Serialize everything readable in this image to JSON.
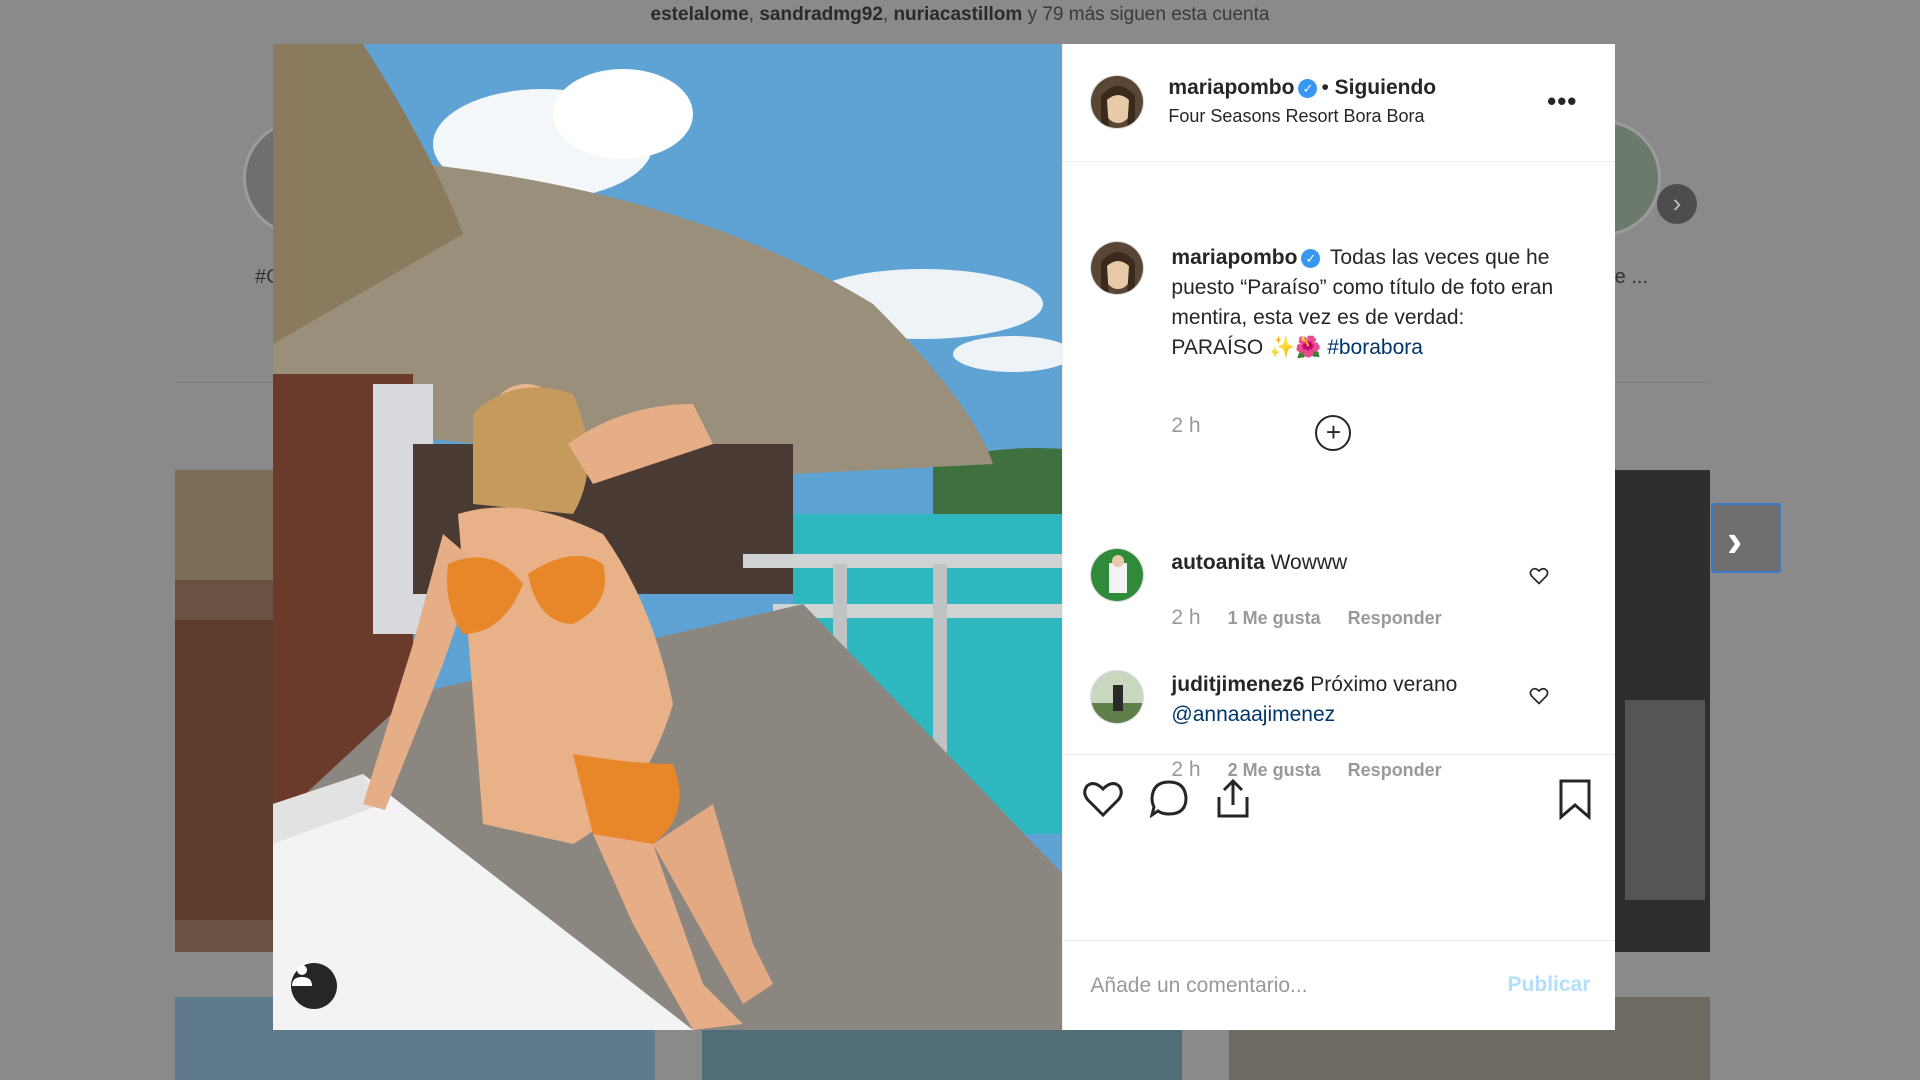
{
  "background": {
    "followed_by": {
      "users": [
        "estelalome",
        "sandradmg92",
        "nuriacastillom"
      ],
      "rest": "y 79 más siguen esta cuenta"
    },
    "story_labels": [
      "#C",
      "re ..."
    ],
    "next_arrow": "›",
    "story_next_arrow": "›"
  },
  "post": {
    "header": {
      "username": "mariapombo",
      "separator": "•",
      "follow_status": "Siguiendo",
      "location": "Four Seasons Resort Bora Bora",
      "more": "•••"
    },
    "caption": {
      "username": "mariapombo",
      "text": "Todas las veces que he puesto “Paraíso” como título de foto eran mentira, esta vez es de verdad:",
      "line2": "PARAÍSO ✨🌺",
      "hashtag": "#borabora",
      "time": "2 h",
      "load_more": "+"
    },
    "comments": [
      {
        "username": "autoanita",
        "text": "Wowww",
        "mention": "",
        "time": "2 h",
        "likes": "1 Me gusta",
        "reply": "Responder"
      },
      {
        "username": "juditjimenez6",
        "text": "Próximo verano",
        "mention": "@annaaajimenez",
        "time": "2 h",
        "likes": "2 Me gusta",
        "reply": "Responder"
      }
    ],
    "actions": [
      "heart-icon",
      "comment-icon",
      "share-icon",
      "bookmark-icon"
    ],
    "add_comment": {
      "placeholder": "Añade un comentario...",
      "publish": "Publicar"
    }
  },
  "colors": {
    "overlay": "#8a8a8a",
    "verified": "#3897f0",
    "link": "#003569",
    "publish_disabled": "#b2dffc",
    "bikini": "#e8862a",
    "lagoon": "#2fb7c0"
  }
}
